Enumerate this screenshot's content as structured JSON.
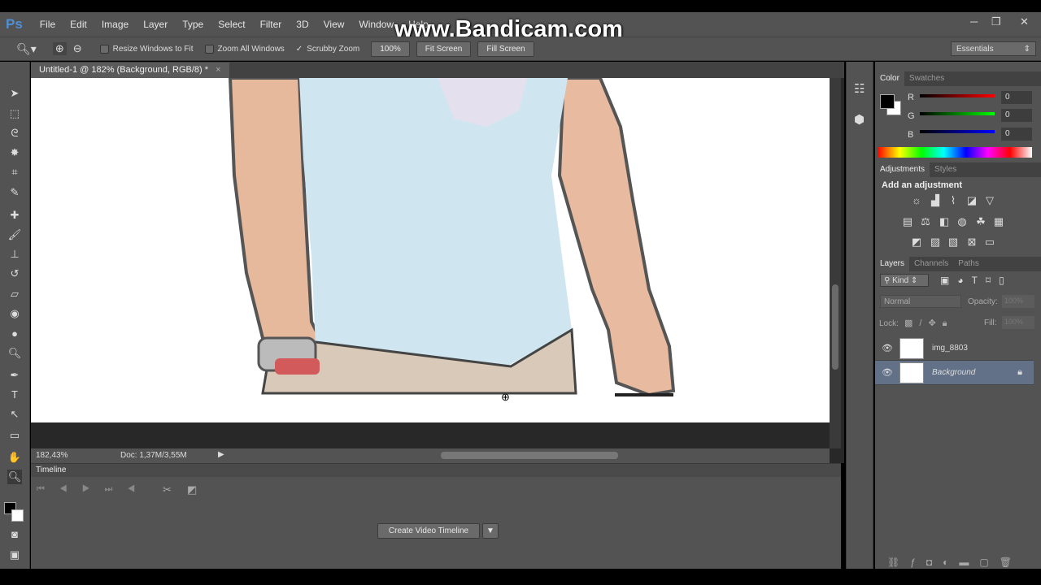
{
  "app": {
    "logo": "Ps",
    "watermark": "www.Bandicam.com"
  },
  "menu": [
    "File",
    "Edit",
    "Image",
    "Layer",
    "Type",
    "Select",
    "Filter",
    "3D",
    "View",
    "Window",
    "Help"
  ],
  "window_controls": {
    "minimize": "─",
    "restore": "❐",
    "close": "✕"
  },
  "options": {
    "resize_windows": "Resize Windows to Fit",
    "zoom_all": "Zoom All Windows",
    "scrubby_zoom": "Scrubby Zoom",
    "btn_100": "100%",
    "fit_screen": "Fit Screen",
    "fill_screen": "Fill Screen",
    "workspace": "Essentials",
    "scrubby_checked": true
  },
  "document": {
    "tab_title": "Untitled-1 @ 182% (Background, RGB/8) *",
    "close": "×"
  },
  "status": {
    "zoom": "182,43%",
    "doc": "Doc: 1,37M/3,55M"
  },
  "timeline": {
    "title": "Timeline",
    "create_button": "Create Video Timeline"
  },
  "color_panel": {
    "tabs": [
      "Color",
      "Swatches"
    ],
    "r_label": "R",
    "g_label": "G",
    "b_label": "B",
    "r": "0",
    "g": "0",
    "b": "0",
    "foreground": "#000000",
    "background": "#ffffff"
  },
  "adjustments_panel": {
    "tabs": [
      "Adjustments",
      "Styles"
    ],
    "heading": "Add an adjustment"
  },
  "layers_panel": {
    "tabs": [
      "Layers",
      "Channels",
      "Paths"
    ],
    "kind": "Kind",
    "blend_mode": "Normal",
    "opacity_label": "Opacity:",
    "opacity": "100%",
    "lock_label": "Lock:",
    "fill_label": "Fill:",
    "fill": "100%",
    "layers": [
      {
        "name": "img_8803",
        "visible": true,
        "selected": false
      },
      {
        "name": "Background",
        "visible": true,
        "selected": true,
        "locked": true
      }
    ]
  }
}
